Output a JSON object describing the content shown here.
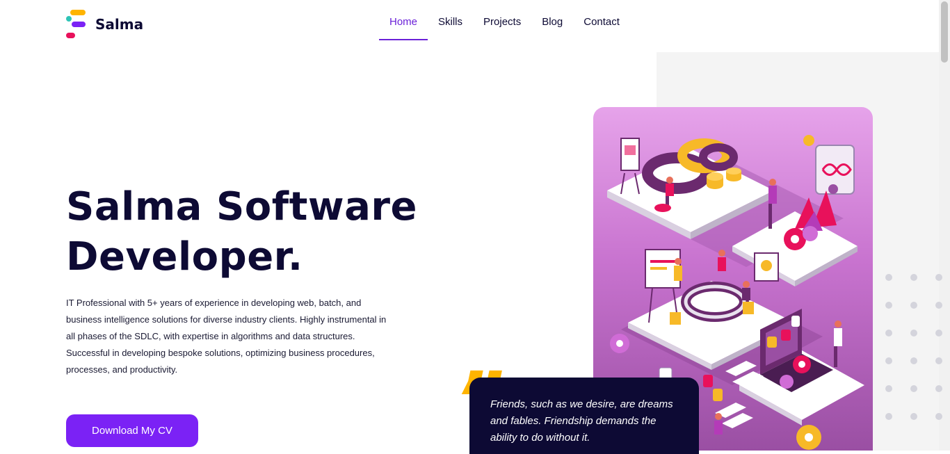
{
  "brand": {
    "name": "Salma",
    "colors": [
      "#ffb400",
      "#2ec4b6",
      "#7b22f5",
      "#e8115b"
    ]
  },
  "nav": {
    "items": [
      {
        "label": "Home",
        "active": true
      },
      {
        "label": "Skills",
        "active": false
      },
      {
        "label": "Projects",
        "active": false
      },
      {
        "label": "Blog",
        "active": false
      },
      {
        "label": "Contact",
        "active": false
      }
    ]
  },
  "hero": {
    "title_line1": "Salma Software",
    "title_line2": "Developer.",
    "description": "IT Professional with 5+ years of experience in developing web, batch, and business intelligence solutions for diverse industry clients. Highly instrumental in all phases of the SDLC, with expertise in algorithms and data structures. Successful in developing bespoke solutions, optimizing business procedures, processes, and productivity.",
    "cta_label": "Download My CV"
  },
  "quote": {
    "mark": "”",
    "text": "Friends, such as we desire, are dreams and fables. Friendship demands the ability to do without it."
  },
  "illustration": {
    "subject": "isometric office teamwork illustration"
  },
  "theme": {
    "accent": "#7b22f5",
    "nav_active": "#6b21d8",
    "dark": "#0d0a34",
    "quote_mark": "#ffb400"
  }
}
